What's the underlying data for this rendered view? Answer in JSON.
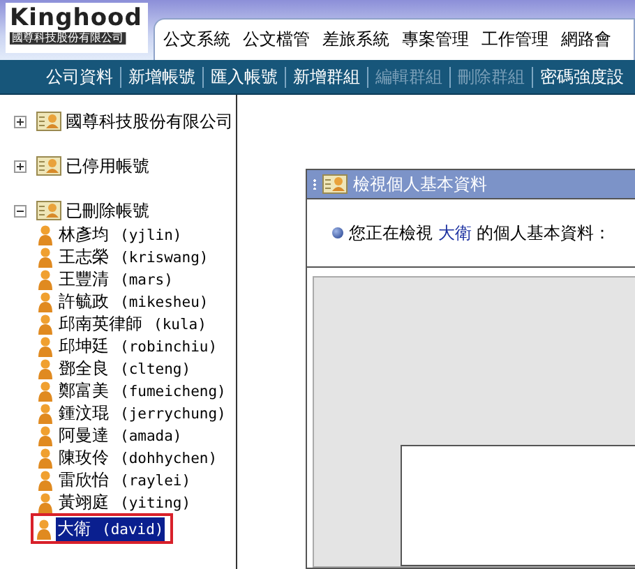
{
  "logo": {
    "name": "Kinghood",
    "subtitle": "國尊科技股份有限公司"
  },
  "tabs": [
    {
      "label": "公文系統"
    },
    {
      "label": "公文檔管"
    },
    {
      "label": "差旅系統"
    },
    {
      "label": "專案管理"
    },
    {
      "label": "工作管理"
    },
    {
      "label": "網路會"
    }
  ],
  "toolbar": [
    {
      "label": "公司資料",
      "disabled": false
    },
    {
      "label": "新增帳號",
      "disabled": false
    },
    {
      "label": "匯入帳號",
      "disabled": false
    },
    {
      "label": "新增群組",
      "disabled": false
    },
    {
      "label": "編輯群組",
      "disabled": true
    },
    {
      "label": "刪除群組",
      "disabled": true
    },
    {
      "label": "密碼強度設",
      "disabled": false
    }
  ],
  "tree": [
    {
      "label": "國尊科技股份有限公司",
      "expanded": false
    },
    {
      "label": "已停用帳號",
      "expanded": false
    },
    {
      "label": "已刪除帳號",
      "expanded": true,
      "children": [
        {
          "name": "林彥均",
          "account": "(yjlin)",
          "selected": false
        },
        {
          "name": "王志榮",
          "account": "(kriswang)",
          "selected": false
        },
        {
          "name": "王豐清",
          "account": "(mars)",
          "selected": false
        },
        {
          "name": "許毓政",
          "account": "(mikesheu)",
          "selected": false
        },
        {
          "name": "邱南英律師",
          "account": "(kula)",
          "selected": false
        },
        {
          "name": "邱坤廷",
          "account": "(robinchiu)",
          "selected": false
        },
        {
          "name": "鄧全良",
          "account": "(clteng)",
          "selected": false
        },
        {
          "name": "鄭富美",
          "account": "(fumeicheng)",
          "selected": false
        },
        {
          "name": "鍾汶琨",
          "account": "(jerrychung)",
          "selected": false
        },
        {
          "name": "阿曼達",
          "account": "(amada)",
          "selected": false
        },
        {
          "name": "陳玫伶",
          "account": "(dohhychen)",
          "selected": false
        },
        {
          "name": "雷欣怡",
          "account": "(raylei)",
          "selected": false
        },
        {
          "name": "黃翊庭",
          "account": "(yiting)",
          "selected": false
        },
        {
          "name": "大衛",
          "account": "(david)",
          "selected": true
        }
      ]
    }
  ],
  "panel": {
    "title": "檢視個人基本資料",
    "info": {
      "before": "您正在檢視",
      "name": "大衛",
      "after": "的個人基本資料："
    }
  }
}
